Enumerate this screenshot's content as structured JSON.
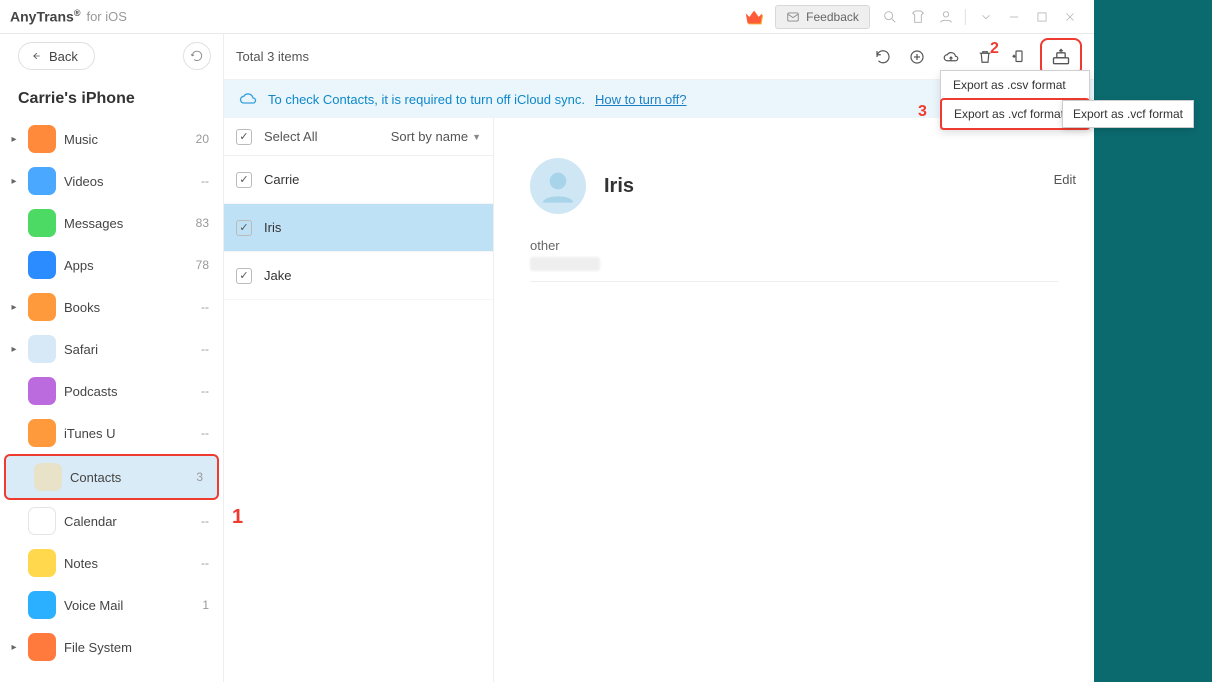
{
  "titlebar": {
    "brand": "AnyTrans",
    "brand_sup": "®",
    "brand_sub": "for iOS",
    "feedback": "Feedback"
  },
  "sidebar": {
    "back": "Back",
    "device": "Carrie's iPhone",
    "items": [
      {
        "label": "Music",
        "count": "20",
        "expand": true,
        "bg": "#ff8a3c"
      },
      {
        "label": "Videos",
        "count": "--",
        "expand": true,
        "bg": "#4aa8ff"
      },
      {
        "label": "Messages",
        "count": "83",
        "expand": false,
        "bg": "#4cd964"
      },
      {
        "label": "Apps",
        "count": "78",
        "expand": false,
        "bg": "#2b8cff"
      },
      {
        "label": "Books",
        "count": "--",
        "expand": true,
        "bg": "#ff9a3c"
      },
      {
        "label": "Safari",
        "count": "--",
        "expand": true,
        "bg": "#d7e9f7"
      },
      {
        "label": "Podcasts",
        "count": "--",
        "expand": false,
        "bg": "#bb6bde"
      },
      {
        "label": "iTunes U",
        "count": "--",
        "expand": false,
        "bg": "#ff9a3c"
      },
      {
        "label": "Contacts",
        "count": "3",
        "expand": false,
        "bg": "#e8e2c8",
        "active": true,
        "hl": true
      },
      {
        "label": "Calendar",
        "count": "--",
        "expand": false,
        "bg": "#ffffff"
      },
      {
        "label": "Notes",
        "count": "--",
        "expand": false,
        "bg": "#ffd84d"
      },
      {
        "label": "Voice Mail",
        "count": "1",
        "expand": false,
        "bg": "#2bb0ff"
      },
      {
        "label": "File System",
        "count": "",
        "expand": true,
        "bg": "#ff7a3c"
      }
    ]
  },
  "toolbar": {
    "total": "Total 3 items"
  },
  "banner": {
    "text": "To check Contacts, it is required to turn off iCloud sync.",
    "link": "How to turn off?"
  },
  "listHeader": {
    "selectAll": "Select All",
    "sort": "Sort by name"
  },
  "contacts": [
    {
      "name": "Carrie",
      "checked": true,
      "selected": false
    },
    {
      "name": "Iris",
      "checked": true,
      "selected": true
    },
    {
      "name": "Jake",
      "checked": true,
      "selected": false
    }
  ],
  "detail": {
    "name": "Iris",
    "field_label": "other",
    "edit": "Edit"
  },
  "dropdown": {
    "optCsv": "Export as .csv format",
    "optVcf": "Export as .vcf format"
  },
  "tooltip": "Export as .vcf format",
  "annotations": {
    "a1": "1",
    "a2": "2",
    "a3": "3"
  }
}
